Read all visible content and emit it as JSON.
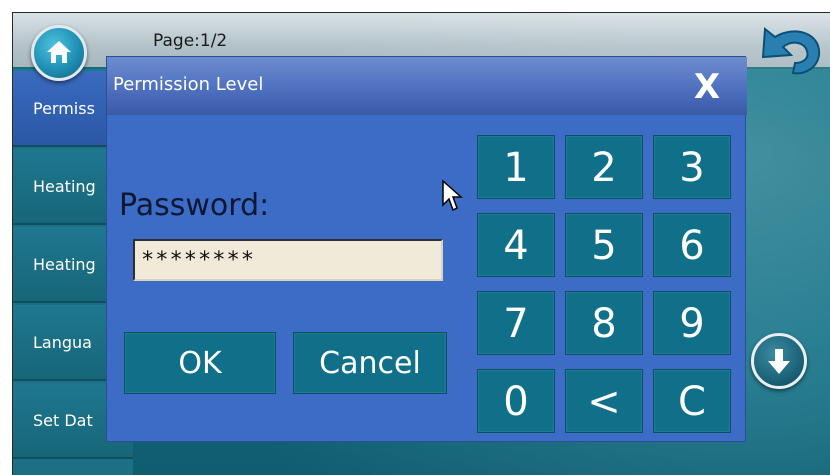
{
  "header": {
    "page_indicator": "Page:1/2"
  },
  "icons": {
    "home": "home-icon",
    "back": "back-arrow-icon",
    "down": "down-arrow-icon",
    "close": "close-icon",
    "cursor": "mouse-pointer-icon"
  },
  "sidebar": {
    "items": [
      {
        "label": "Permiss",
        "active": true
      },
      {
        "label": "Heating"
      },
      {
        "label": "Heating"
      },
      {
        "label": "Langua"
      },
      {
        "label": "Set Dat"
      }
    ]
  },
  "dialog": {
    "title": "Permission Level",
    "close_label": "X",
    "password_label": "Password:",
    "password_value": "********",
    "ok_label": "OK",
    "cancel_label": "Cancel",
    "keypad": [
      "1",
      "2",
      "3",
      "4",
      "5",
      "6",
      "7",
      "8",
      "9",
      "0",
      "<",
      "C"
    ]
  },
  "colors": {
    "dialog_bg": "#3d6cc6",
    "key_bg": "#10708a",
    "sidebar_bg": "#1d6f85",
    "field_bg": "#f1ead8"
  }
}
